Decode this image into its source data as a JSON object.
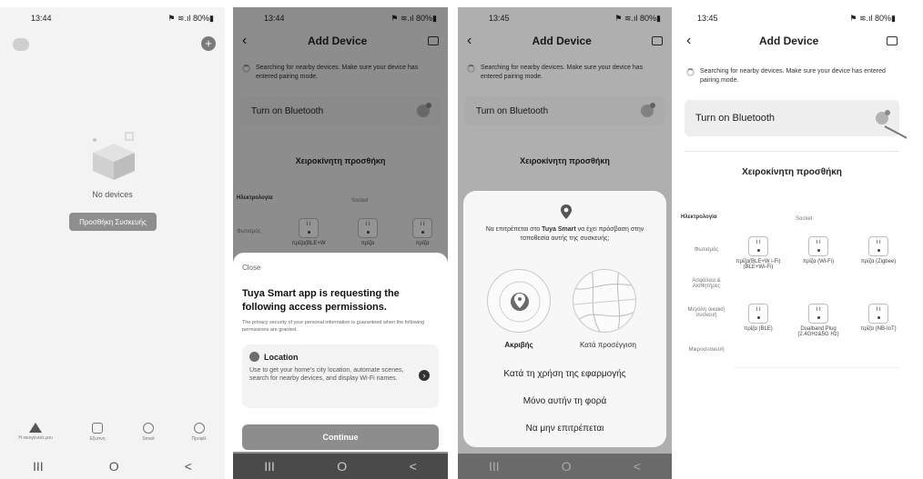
{
  "phone1": {
    "time": "13:44",
    "status_icons": "⚑ ≋.ıl 80%▮",
    "empty_text": "No devices",
    "add_button": "Προσθήκη Συσκευής",
    "tabs": [
      "Η οικογένειά μου",
      "Εξυπνη",
      "Smart",
      "Προφίλ"
    ],
    "nav": [
      "III",
      "O",
      "<"
    ]
  },
  "phone2": {
    "time": "13:44",
    "status_icons": "⚑ ≋.ıl 80%▮",
    "title": "Add Device",
    "search_text": "Searching for nearby devices. Make sure your device has entered pairing mode.",
    "bluetooth": "Turn on Bluetooth",
    "manual": "Χειροκίνητη προσθήκη",
    "category": "Ηλεκτρολογία",
    "sub_category": "Socket",
    "row_label": "Φωτισμός",
    "devices": [
      "πρίζα(BLE+W",
      "πρίζα",
      "πρίζα"
    ],
    "sheet": {
      "close": "Close",
      "heading": "Tuya Smart app is requesting the following access permissions.",
      "privacy": "The privacy security of your personal information is guaranteed when the following permissions are granted.",
      "perm_title": "Location",
      "perm_desc": "Use to get your home's city location, automate scenes, search for nearby devices, and display Wi-Fi names.",
      "continue": "Continue"
    },
    "nav": [
      "III",
      "O",
      "<"
    ]
  },
  "phone3": {
    "time": "13:45",
    "status_icons": "⚑ ≋.ıl 80%▮",
    "title": "Add Device",
    "search_text": "Searching for nearby devices. Make sure your device has entered pairing mode.",
    "bluetooth": "Turn on Bluetooth",
    "manual": "Χειροκίνητη προσθήκη",
    "dialog": {
      "text_pre": "Να επιτρέπεται στο ",
      "text_app": "Tuya Smart",
      "text_post": " να έχει πρόσβαση στην τοποθεσία αυτής της συσκευής;",
      "precise": "Ακριβής",
      "approximate": "Κατά προσέγγιση",
      "option1": "Κατά τη χρήση της εφαρμογής",
      "option2": "Μόνο αυτήν τη φορά",
      "option3": "Να μην επιτρέπεται"
    },
    "nav": [
      "III",
      "O",
      "<"
    ]
  },
  "phone4": {
    "time": "13:45",
    "status_icons": "⚑ ≋.ıl 80%▮",
    "title": "Add Device",
    "search_text": "Searching for nearby devices. Make sure your device has entered pairing mode.",
    "bluetooth": "Turn on Bluetooth",
    "manual": "Χειροκίνητη προσθήκη",
    "category": "Ηλεκτρολογία",
    "sub_category": "Socket",
    "side_labels": [
      "Φωτισμός",
      "Ασφάλεια & Αισθητήρες",
      "Μεγάλη οικιακή συσκευή",
      "Μικροσυσκευή"
    ],
    "devices_row1": [
      "πρίζα(BLE+W i-Fi) (BLE+Wi-Fi)",
      "πρίζα (Wi-Fi)",
      "πρίζα (Zigbee)"
    ],
    "devices_row2": [
      "πρίζα (BLE)",
      "Dualband Plug (2.4GHz&5G Hz)",
      "πρίζα (NB-IoT)"
    ]
  }
}
